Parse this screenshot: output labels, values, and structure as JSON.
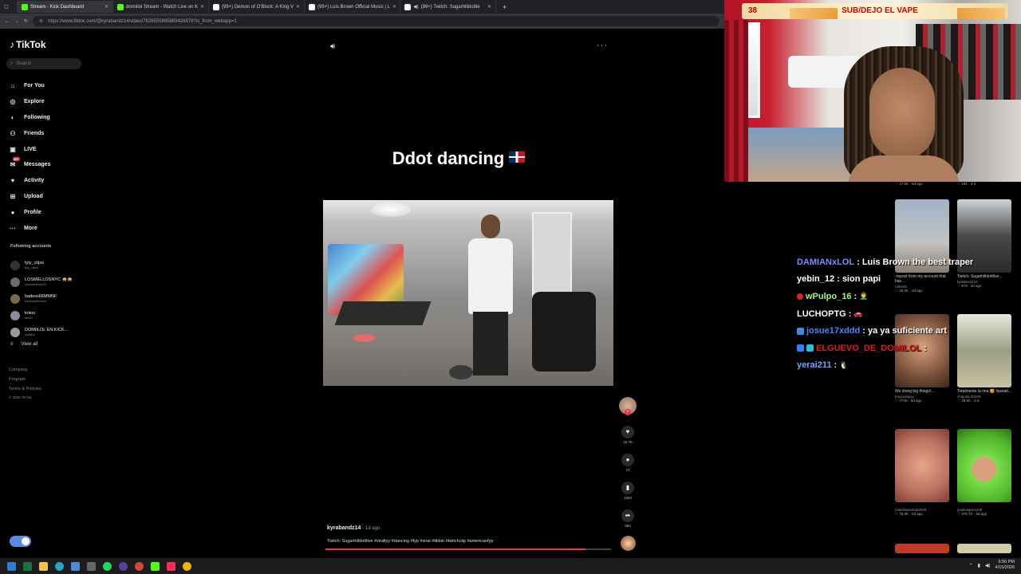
{
  "browser": {
    "tabs": [
      {
        "title": "Stream - Kick Dashboard",
        "color": "#53fc18"
      },
      {
        "title": "domiilol Stream - Watch Live on K",
        "color": "#53fc18"
      },
      {
        "title": "(99+) Demon of O'Block: A King V",
        "color": "#ffffff"
      },
      {
        "title": "(99+) Luis Brown Official Music | L",
        "color": "#ffffff"
      },
      {
        "title": "(99+) Twitch: Sugarhilldottie",
        "color": "#ffffff"
      }
    ],
    "new_tab_icon": "+",
    "url": "https://www.tiktok.com/@kyrabandz14/video/7628555895869426976?is_from_webapp=1"
  },
  "tiktok": {
    "logo": "TikTok",
    "search_placeholder": "Search",
    "nav": [
      {
        "label": "For You",
        "icon": "home-icon",
        "glyph": "⌂"
      },
      {
        "label": "Explore",
        "icon": "compass-icon",
        "glyph": "◎"
      },
      {
        "label": "Following",
        "icon": "following-icon",
        "glyph": "◐"
      },
      {
        "label": "Friends",
        "icon": "friends-icon",
        "glyph": "⚇"
      },
      {
        "label": "LIVE",
        "icon": "live-icon",
        "glyph": "▣"
      },
      {
        "label": "Messages",
        "icon": "messages-icon",
        "glyph": "✉"
      },
      {
        "label": "Activity",
        "icon": "activity-icon",
        "glyph": "♥"
      },
      {
        "label": "Upload",
        "icon": "upload-icon",
        "glyph": "⊞"
      },
      {
        "label": "Profile",
        "icon": "profile-icon",
        "glyph": "●"
      },
      {
        "label": "More",
        "icon": "more-icon",
        "glyph": "···"
      }
    ],
    "messages_badge": "99+",
    "following_accounts_title": "Following accounts",
    "accounts": [
      {
        "name": "tyty_clipsi",
        "handle": "tyty_clipsi"
      },
      {
        "name": "LOSMELLOSNYC 🙊🙊",
        "handle": "losmellosnyc22"
      },
      {
        "name": "hadess66MMNF",
        "handle": "hadess66mmnf"
      },
      {
        "name": "kriiou",
        "handle": "kriiou"
      },
      {
        "name": "DOMIILOL EN KICK...",
        "handle": "ogdiilol"
      }
    ],
    "view_all": "View all",
    "footer": [
      "Company",
      "Program",
      "Terms & Policies"
    ],
    "copyright": "© 2026 TikTok",
    "video_title": "Ddot dancing",
    "author": "kyrabandz14",
    "posted": "· 1d ago",
    "caption": "Twitch: Sugarhilldottlive #viraltyy #dancing #fyp #viral #tiktok #twitchclip #americanfyp",
    "progress": 0.91,
    "actions": [
      {
        "icon": "heart-icon",
        "glyph": "♥",
        "count": "16.7K"
      },
      {
        "icon": "comment-icon",
        "glyph": "●",
        "count": "74"
      },
      {
        "icon": "bookmark-icon",
        "glyph": "▮",
        "count": "1653"
      },
      {
        "icon": "share-icon",
        "glyph": "➦",
        "count": "984"
      }
    ]
  },
  "overlay": {
    "count": "38",
    "banner_text": "SUB/DEJO EL VAPE"
  },
  "chat": [
    {
      "user": "DAMIANxLOL",
      "color": "#7c8cff",
      "msg": ": Luis Brown the best traper",
      "badge": ""
    },
    {
      "user": "yebin_12",
      "color": "#ffffff",
      "msg": ": sion papi",
      "badge": ""
    },
    {
      "user": "wPulpo_16",
      "color": "#9dff5c",
      "msg": ":",
      "badge": "#e02020"
    },
    {
      "user": "LUCHOPTG",
      "color": "#ffffff",
      "msg": ":",
      "badge": ""
    },
    {
      "user": "josue17xddd",
      "color": "#4a86ff",
      "msg": ": ya ya suficiente art",
      "badge": "#3a8dde"
    },
    {
      "user": "ELGUEVO_DE_DOMILOL",
      "color": "#e11b1b",
      "msg": ":",
      "badge": "#2f80ff"
    },
    {
      "user": "yerai211",
      "color": "#6fa8ff",
      "msg": ":",
      "badge": ""
    }
  ],
  "grid": [
    {
      "caption": "",
      "user": "",
      "stats": "♡ 17.6K · 5d ago",
      "bg": "#444444"
    },
    {
      "caption": "",
      "user": "",
      "stats": "♡ 341 · 4-4",
      "bg": "#444444"
    },
    {
      "caption": "-repost from my account that has...",
      "user": "n3ne45",
      "stats": "♡ 26.4K · 2d ago",
      "bg": "#8b8f93"
    },
    {
      "caption": "Twitch: Sugarhilldottlive...",
      "user": "kyrabandz14",
      "stats": "♡ 579 · 2d ago",
      "bg": "#9a9a9a"
    },
    {
      "caption": "We doing big things!...",
      "user": "treyyxdayyy",
      "stats": "♡ 771K · 5d ago",
      "bg": "#a2826a"
    },
    {
      "caption": "Totalmente la mía 🥰 #paratí...",
      "user": "chiquita.20100",
      "stats": "♡ 39.6K · 4-6",
      "bg": "#b4b0a0"
    },
    {
      "caption": "",
      "user": "maitellaorienta2025",
      "stats": "♡ 78.3K · 6d ago",
      "bg": "#c9896e"
    },
    {
      "caption": "",
      "user": "joseluisperez09",
      "stats": "♡ 376.7K · 5d ago",
      "bg": "#7ae04a"
    }
  ],
  "taskbar": {
    "time": "6:56 PM",
    "date": "4/15/2026"
  }
}
